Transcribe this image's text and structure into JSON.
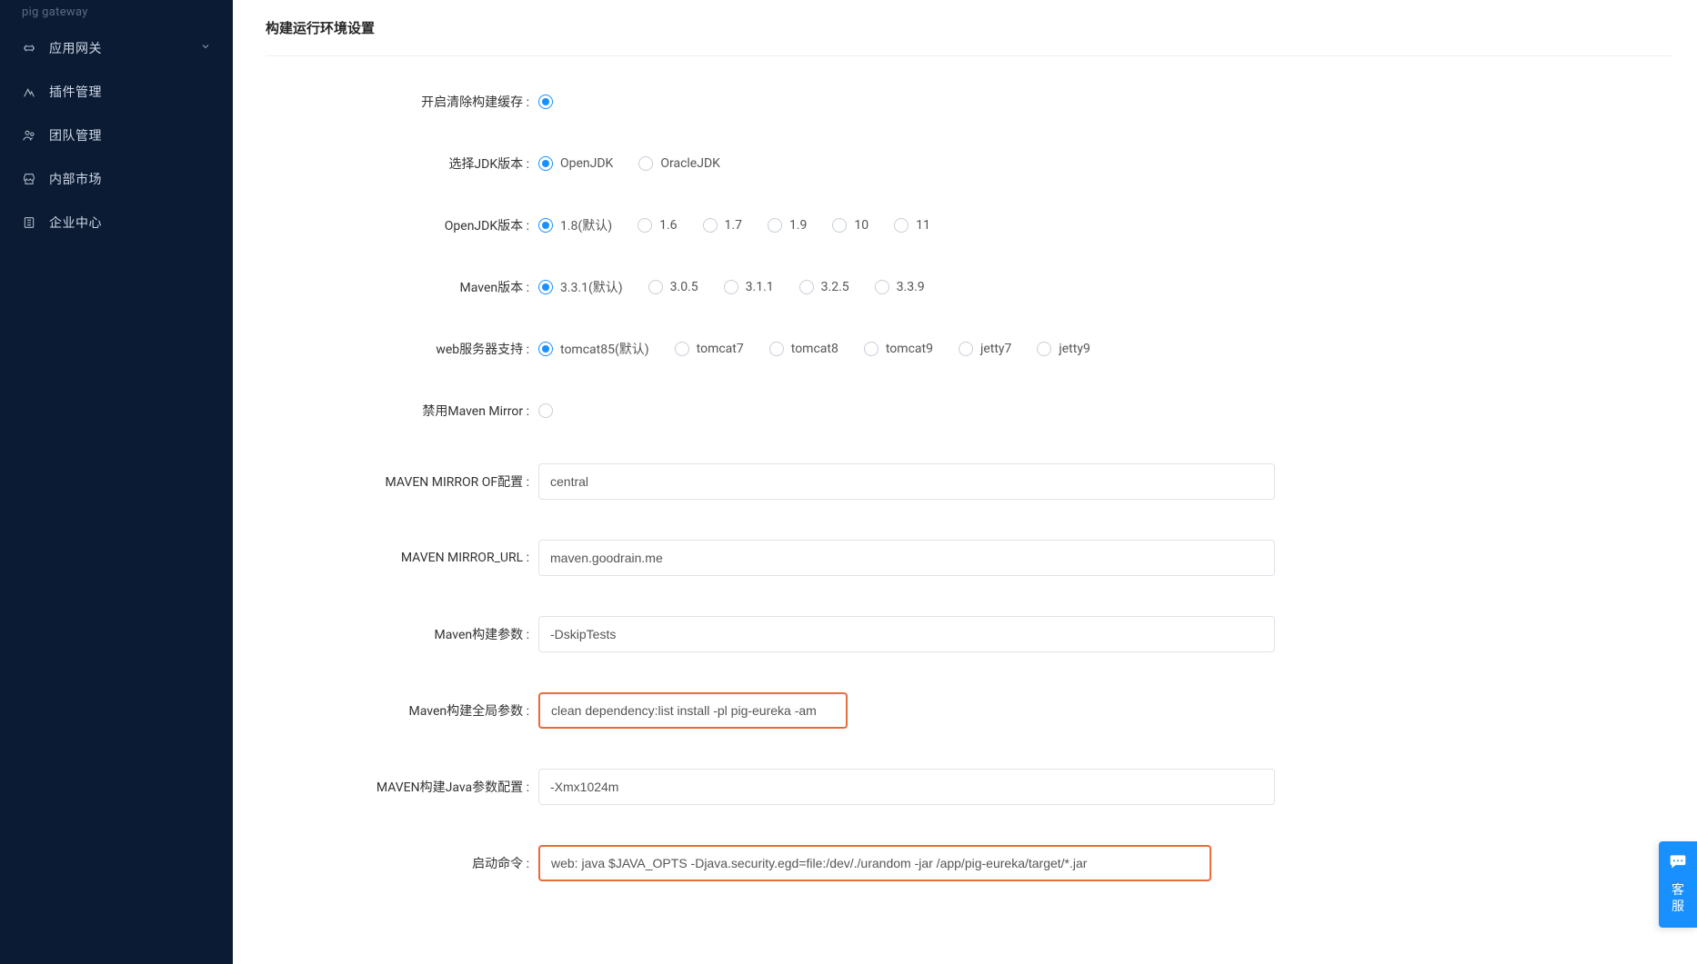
{
  "sidebar": {
    "top_text": "pig gateway",
    "items": [
      {
        "label": "应用网关",
        "icon": "gateway-icon",
        "has_caret": true
      },
      {
        "label": "插件管理",
        "icon": "plugin-icon",
        "has_caret": false
      },
      {
        "label": "团队管理",
        "icon": "team-icon",
        "has_caret": false
      },
      {
        "label": "内部市场",
        "icon": "market-icon",
        "has_caret": false
      },
      {
        "label": "企业中心",
        "icon": "enterprise-icon",
        "has_caret": false
      }
    ]
  },
  "main": {
    "title": "构建运行环境设置",
    "form": {
      "clear_cache": {
        "label": "开启清除构建缓存 :",
        "selected": true
      },
      "jdk_version": {
        "label": "选择JDK版本 :",
        "options": [
          {
            "label": "OpenJDK",
            "selected": true
          },
          {
            "label": "OracleJDK",
            "selected": false
          }
        ]
      },
      "openjdk_version": {
        "label": "OpenJDK版本 :",
        "options": [
          {
            "label": "1.8(默认)",
            "selected": true
          },
          {
            "label": "1.6",
            "selected": false
          },
          {
            "label": "1.7",
            "selected": false
          },
          {
            "label": "1.9",
            "selected": false
          },
          {
            "label": "10",
            "selected": false
          },
          {
            "label": "11",
            "selected": false
          }
        ]
      },
      "maven_version": {
        "label": "Maven版本 :",
        "options": [
          {
            "label": "3.3.1(默认)",
            "selected": true
          },
          {
            "label": "3.0.5",
            "selected": false
          },
          {
            "label": "3.1.1",
            "selected": false
          },
          {
            "label": "3.2.5",
            "selected": false
          },
          {
            "label": "3.3.9",
            "selected": false
          }
        ]
      },
      "web_server": {
        "label": "web服务器支持 :",
        "options": [
          {
            "label": "tomcat85(默认)",
            "selected": true
          },
          {
            "label": "tomcat7",
            "selected": false
          },
          {
            "label": "tomcat8",
            "selected": false
          },
          {
            "label": "tomcat9",
            "selected": false
          },
          {
            "label": "jetty7",
            "selected": false
          },
          {
            "label": "jetty9",
            "selected": false
          }
        ]
      },
      "disable_mirror": {
        "label": "禁用Maven Mirror :",
        "selected": false
      },
      "mirror_of": {
        "label": "MAVEN MIRROR OF配置 :",
        "value": "central"
      },
      "mirror_url": {
        "label": "MAVEN MIRROR_URL :",
        "value": "maven.goodrain.me"
      },
      "maven_build_args": {
        "label": "Maven构建参数 :",
        "value": "-DskipTests"
      },
      "maven_build_global_args": {
        "label": "Maven构建全局参数 :",
        "value": "clean dependency:list install -pl pig-eureka -am",
        "highlight": true
      },
      "maven_java_args": {
        "label": "MAVEN构建Java参数配置 :",
        "value": "-Xmx1024m"
      },
      "start_cmd": {
        "label": "启动命令 :",
        "value": "web: java $JAVA_OPTS -Djava.security.egd=file:/dev/./urandom -jar /app/pig-eureka/target/*.jar",
        "highlight": true
      }
    }
  },
  "support": {
    "label_line1": "客",
    "label_line2": "服"
  }
}
